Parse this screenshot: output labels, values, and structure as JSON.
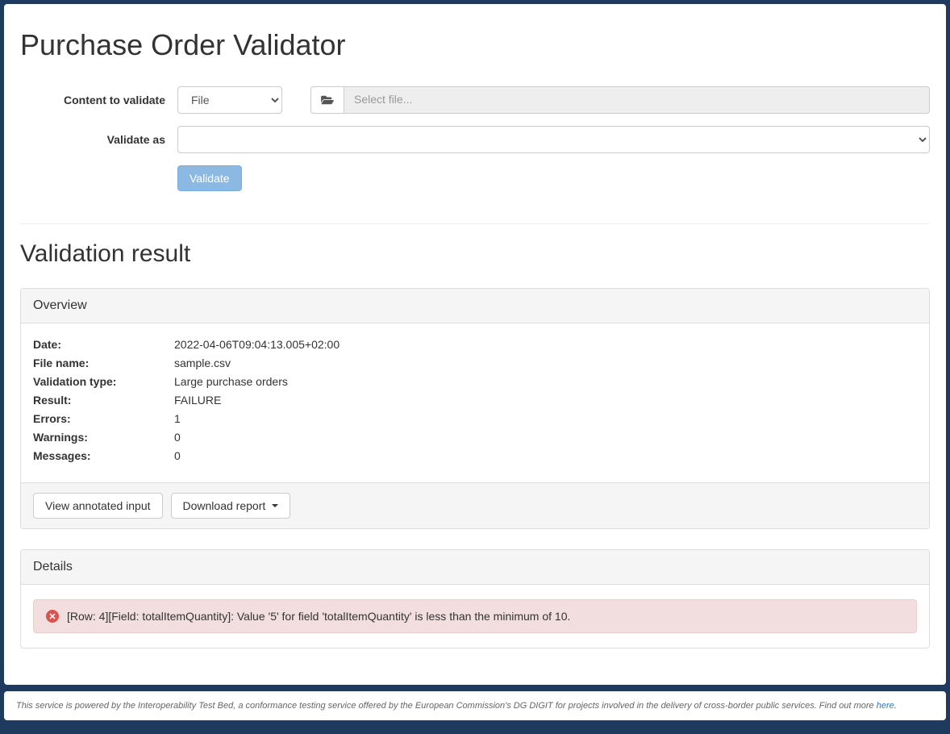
{
  "page": {
    "title": "Purchase Order Validator",
    "result_title": "Validation result"
  },
  "form": {
    "content_label": "Content to validate",
    "content_type_selected": "File",
    "file_placeholder": "Select file...",
    "validate_as_label": "Validate as",
    "validate_button": "Validate"
  },
  "overview": {
    "heading": "Overview",
    "date_label": "Date:",
    "date_value": "2022-04-06T09:04:13.005+02:00",
    "filename_label": "File name:",
    "filename_value": "sample.csv",
    "validation_type_label": "Validation type:",
    "validation_type_value": "Large purchase orders",
    "result_label": "Result:",
    "result_value": "FAILURE",
    "errors_label": "Errors:",
    "errors_value": "1",
    "warnings_label": "Warnings:",
    "warnings_value": "0",
    "messages_label": "Messages:",
    "messages_value": "0",
    "view_annotated_btn": "View annotated input",
    "download_report_btn": "Download report"
  },
  "details": {
    "heading": "Details",
    "error_message": "[Row: 4][Field: totalItemQuantity]: Value '5' for field 'totalItemQuantity' is less than the minimum of 10."
  },
  "footer": {
    "text_before": "This service is powered by the Interoperability Test Bed, a conformance testing service offered by the European Commission's DG DIGIT for projects involved in the delivery of cross-border public services. Find out more ",
    "link_text": "here",
    "text_after": "."
  }
}
